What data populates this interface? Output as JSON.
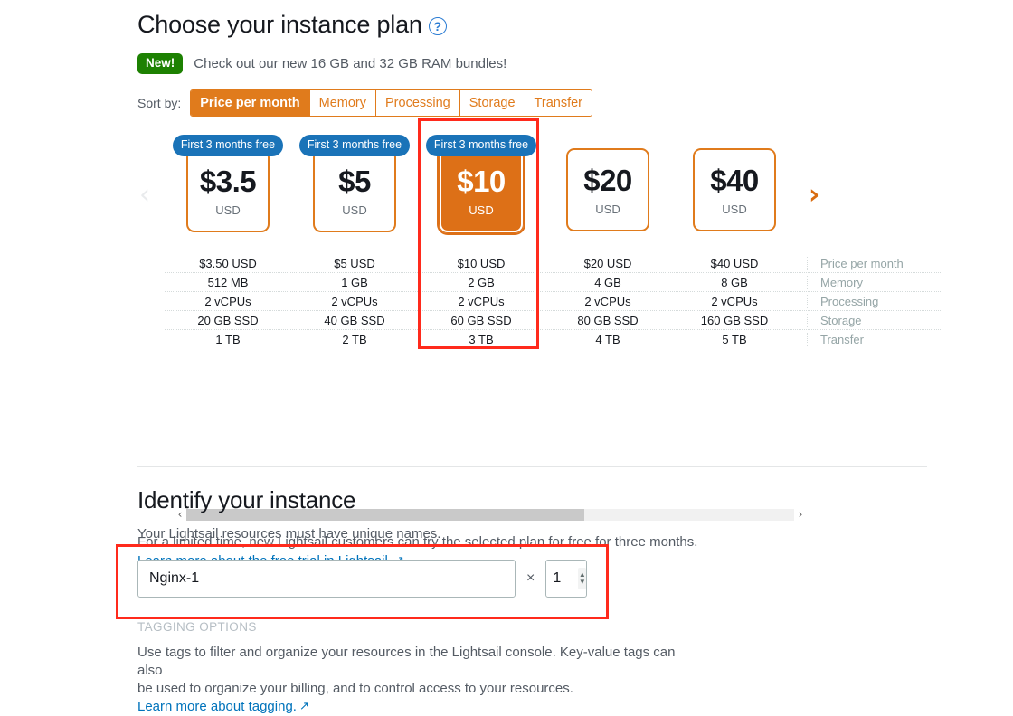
{
  "plan_section": {
    "title": "Choose your instance plan",
    "help_icon": "help-circle-icon",
    "new_badge": "New!",
    "new_text": "Check out our new 16 GB and 32 GB RAM bundles!",
    "sort_label": "Sort by:",
    "sort_tabs": [
      {
        "label": "Price per month",
        "active": true
      },
      {
        "label": "Memory",
        "active": false
      },
      {
        "label": "Processing",
        "active": false
      },
      {
        "label": "Storage",
        "active": false
      },
      {
        "label": "Transfer",
        "active": false
      }
    ],
    "nav_prev": "‹",
    "nav_next": "›",
    "free_badge": "First 3 months free",
    "currency": "USD",
    "plans": [
      {
        "price": "$3.5",
        "selected": false
      },
      {
        "price": "$5",
        "selected": false
      },
      {
        "price": "$10",
        "selected": true
      },
      {
        "price": "$20",
        "selected": false
      },
      {
        "price": "$40",
        "selected": false
      }
    ],
    "spec_labels": [
      "Price per month",
      "Memory",
      "Processing",
      "Storage",
      "Transfer"
    ],
    "spec_rows": [
      [
        "$3.50 USD",
        "$5 USD",
        "$10 USD",
        "$20 USD",
        "$40 USD"
      ],
      [
        "512 MB",
        "1 GB",
        "2 GB",
        "4 GB",
        "8 GB"
      ],
      [
        "2 vCPUs",
        "2 vCPUs",
        "2 vCPUs",
        "2 vCPUs",
        "2 vCPUs"
      ],
      [
        "20 GB SSD",
        "40 GB SSD",
        "60 GB SSD",
        "80 GB SSD",
        "160 GB SSD"
      ],
      [
        "1 TB",
        "2 TB",
        "3 TB",
        "4 TB",
        "5 TB"
      ]
    ],
    "scroll_left": "‹",
    "scroll_right": "›",
    "trial_text": "For a limited time, new Lightsail customers can try the selected plan for free for three months.",
    "trial_link": "Learn more about the free trial in Lightsail.",
    "external_icon": "↗"
  },
  "identify_section": {
    "title": "Identify your instance",
    "subtitle": "Your Lightsail resources must have unique names.",
    "name_value": "Nginx-1",
    "name_placeholder": "",
    "multiplier": "×",
    "quantity": "1",
    "spinner_up": "▲",
    "spinner_down": "▼"
  },
  "tagging_section": {
    "title": "TAGGING OPTIONS",
    "body_line1": "Use tags to filter and organize your resources in the Lightsail console. Key-value tags can also",
    "body_line2": "be used to organize your billing, and to control access to your resources.",
    "link": "Learn more about tagging.",
    "external_icon": "↗"
  },
  "colors": {
    "orange": "#e07b1c",
    "orange_fill": "#dd7017",
    "blue_badge": "#1a73b8",
    "green_badge": "#1d8102",
    "link_blue": "#0073bb",
    "annotation_red": "#ff2a1c",
    "muted_text": "#545b64"
  }
}
